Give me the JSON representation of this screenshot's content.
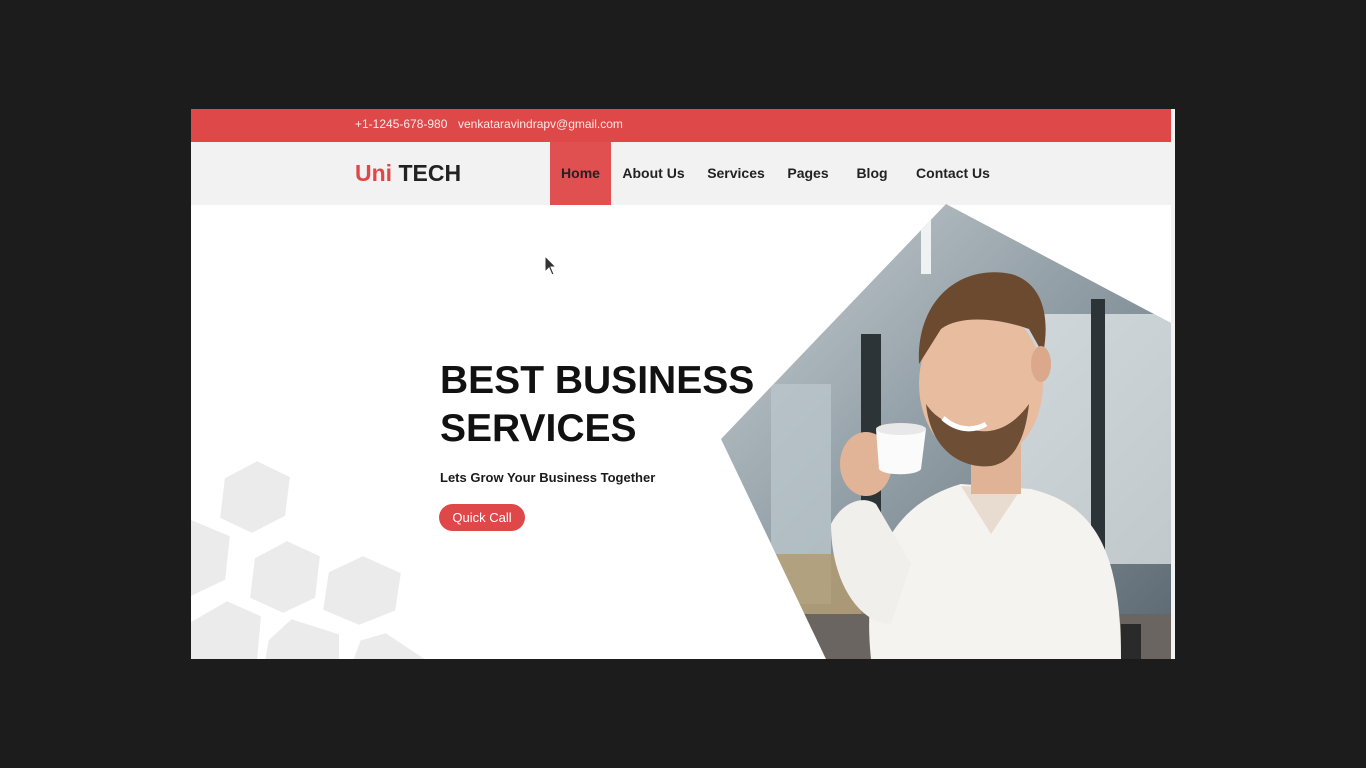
{
  "topbar": {
    "phone": "+1-1245-678-980",
    "email": "venkataravindrapv@gmail.com"
  },
  "logo": {
    "part1": "Uni",
    "part2": " TECH"
  },
  "nav": {
    "items": [
      {
        "label": "Home",
        "active": true
      },
      {
        "label": "About Us"
      },
      {
        "label": "Services"
      },
      {
        "label": "Pages"
      },
      {
        "label": "Blog"
      },
      {
        "label": "Contact Us"
      }
    ]
  },
  "hero": {
    "title_line1": "BEST BUSINESS",
    "title_line2": "SERVICES",
    "subtitle": "Lets Grow Your Business Together",
    "cta_label": "Quick Call"
  },
  "colors": {
    "brand_red": "#df4848",
    "nav_bg": "#f2f2f2",
    "page_bg": "#1c1c1c"
  },
  "icons": [
    "mouse-cursor-icon",
    "hexagon-pattern-decoration"
  ]
}
